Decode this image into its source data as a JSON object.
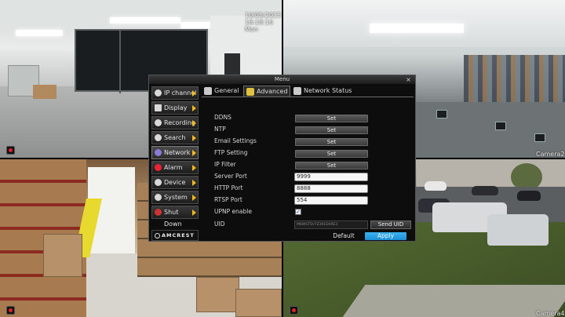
{
  "overlay": {
    "timestamp": "10/05/2015  16:18:16 Mon",
    "cam2_label": "Camera2",
    "cam4_label": "Camera4"
  },
  "menu": {
    "title": "Menu",
    "close": "×",
    "brand": "AMCREST",
    "sidebar": [
      {
        "label": "IP channel",
        "icon": "ip-channel-icon"
      },
      {
        "label": "Display",
        "icon": "display-icon"
      },
      {
        "label": "Recording",
        "icon": "recording-icon"
      },
      {
        "label": "Search",
        "icon": "search-icon"
      },
      {
        "label": "Network",
        "icon": "network-icon"
      },
      {
        "label": "Alarm",
        "icon": "alarm-icon"
      },
      {
        "label": "Device",
        "icon": "device-icon"
      },
      {
        "label": "System",
        "icon": "system-icon"
      },
      {
        "label": "Shut Down",
        "icon": "power-icon"
      }
    ],
    "tabs": [
      {
        "label": "General"
      },
      {
        "label": "Advanced"
      },
      {
        "label": "Network Status"
      }
    ],
    "settings": {
      "ddns": {
        "label": "DDNS",
        "button": "Set"
      },
      "ntp": {
        "label": "NTP",
        "button": "Set"
      },
      "email": {
        "label": "Email Settings",
        "button": "Set"
      },
      "ftp": {
        "label": "FTP Setting",
        "button": "Set"
      },
      "ipfilter": {
        "label": "IP Filter",
        "button": "Set"
      },
      "server_port": {
        "label": "Server Port",
        "value": "9999"
      },
      "http_port": {
        "label": "HTTP Port",
        "value": "8888"
      },
      "rtsp_port": {
        "label": "RTSP Port",
        "value": "554"
      },
      "upnp": {
        "label": "UPNP enable",
        "checked": "✓"
      },
      "uid": {
        "label": "UID",
        "value": "M6WST5V7Z391D4RE1",
        "button": "Send UID"
      }
    },
    "footer": {
      "default": "Default",
      "apply": "Apply"
    },
    "colors": {
      "accent": "#1b8fd6",
      "arrow": "#f2b820",
      "rec": "#e0232a"
    }
  }
}
